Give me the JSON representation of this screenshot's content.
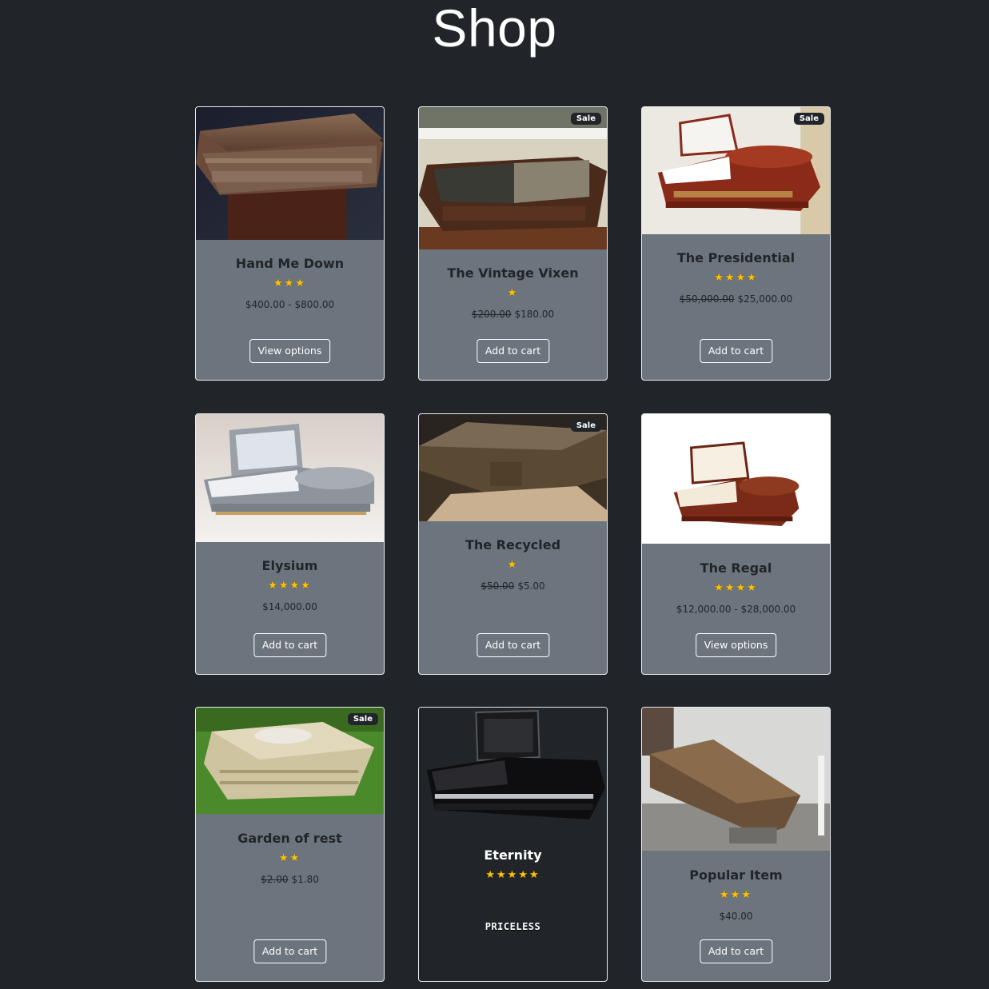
{
  "page": {
    "title": "Shop"
  },
  "sale_label": "Sale",
  "colors": {
    "background": "#212529",
    "card": "#6c757d",
    "star": "#ffc107"
  },
  "products": [
    {
      "name": "Hand Me Down",
      "rating": 3,
      "price": "$400.00 - $800.00",
      "button": "View options",
      "sale": false
    },
    {
      "name": "The Vintage Vixen",
      "rating": 1,
      "old_price": "$200.00",
      "price": "$180.00",
      "button": "Add to cart",
      "sale": true
    },
    {
      "name": "The Presidential",
      "rating": 4,
      "old_price": "$50,000.00",
      "price": "$25,000.00",
      "button": "Add to cart",
      "sale": true
    },
    {
      "name": "Elysium",
      "rating": 4,
      "price": "$14,000.00",
      "button": "Add to cart",
      "sale": false
    },
    {
      "name": "The Recycled",
      "rating": 1,
      "old_price": "$50.00",
      "price": "$5.00",
      "button": "Add to cart",
      "sale": true
    },
    {
      "name": "The Regal",
      "rating": 4,
      "price": "$12,000.00 - $28,000.00",
      "button": "View options",
      "sale": false
    },
    {
      "name": "Garden of rest",
      "rating": 2,
      "old_price": "$2.00",
      "price": "$1.80",
      "button": "Add to cart",
      "sale": true
    },
    {
      "name": "Eternity",
      "rating": 5,
      "price": "PRICELESS",
      "sale": false
    },
    {
      "name": "Popular Item",
      "rating": 3,
      "price": "$40.00",
      "button": "Add to cart",
      "sale": false
    }
  ]
}
